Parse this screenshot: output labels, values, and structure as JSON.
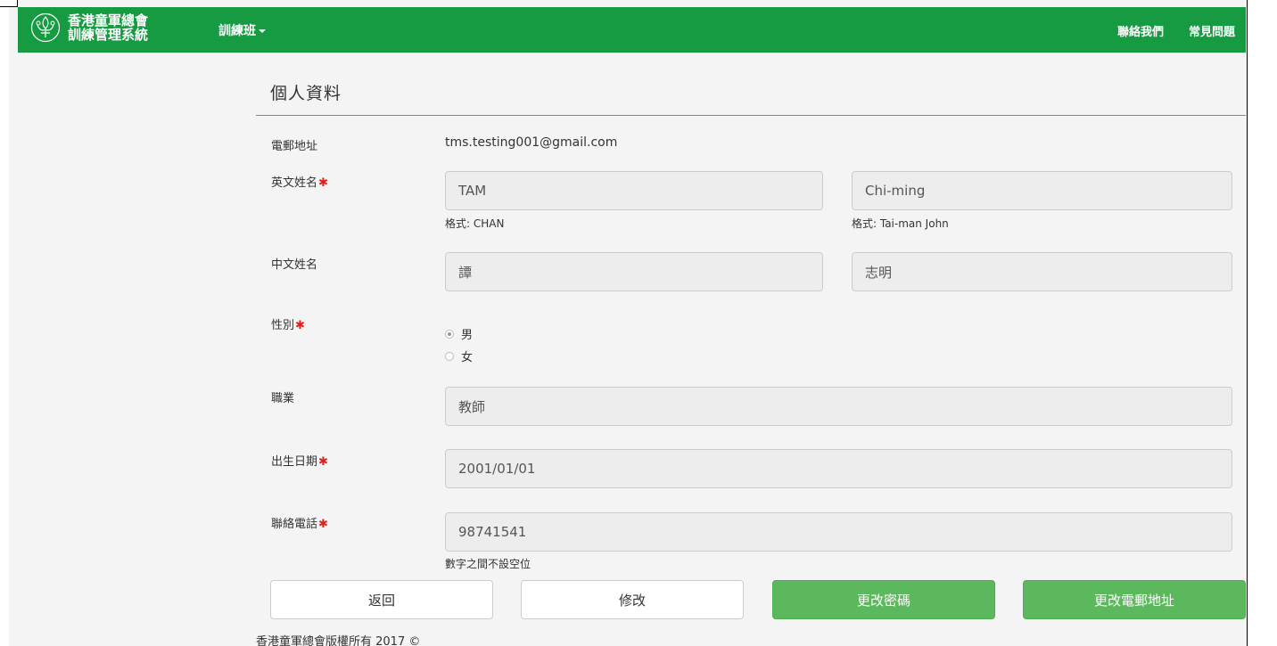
{
  "navbar": {
    "brand_line1": "香港童軍總會",
    "brand_line2": "訓練管理系統",
    "course_menu": "訓練班",
    "contact": "聯絡我們",
    "faq": "常見問題",
    "color": "#169b43"
  },
  "page": {
    "title": "個人資料"
  },
  "form": {
    "email_label": "電郵地址",
    "email_value": "tms.testing001@gmail.com",
    "eng_name_label": "英文姓名",
    "eng_surname": "TAM",
    "eng_surname_hint": "格式: CHAN",
    "eng_given": "Chi-ming",
    "eng_given_hint": "格式: Tai-man John",
    "chi_name_label": "中文姓名",
    "chi_surname": "譚",
    "chi_given": "志明",
    "gender_label": "性別",
    "gender_male": "男",
    "gender_female": "女",
    "gender_selected": "男",
    "occupation_label": "職業",
    "occupation": "教師",
    "dob_label": "出生日期",
    "dob": "2001/01/01",
    "phone_label": "聯絡電話",
    "phone": "98741541",
    "phone_hint": "數字之間不設空位",
    "required_mark": "✱"
  },
  "buttons": {
    "back": "返回",
    "edit": "修改",
    "change_password": "更改密碼",
    "change_email": "更改電郵地址",
    "green_color": "#5cb85c"
  },
  "footer": {
    "copyright": "香港童軍總會版權所有 2017 ©"
  }
}
